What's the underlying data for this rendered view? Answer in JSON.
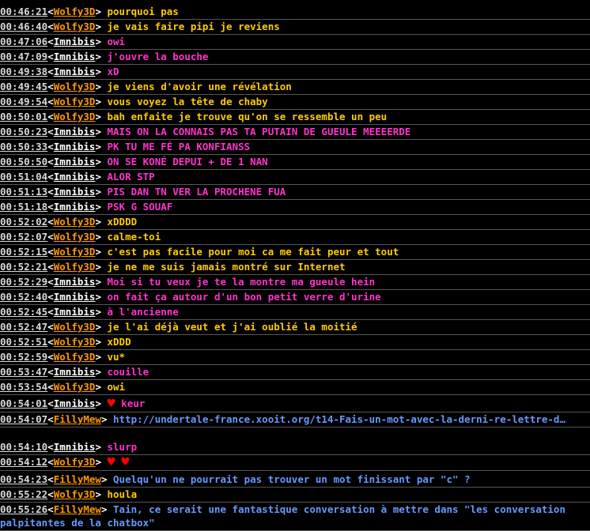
{
  "colors": {
    "wolfy": "#ff9900",
    "imnibis": "#ffffff",
    "fillymew": "#ff9900",
    "wolfy_text": "#ffcc00",
    "imnibis_text": "#ff33cc",
    "fillymew_text": "#6699ff",
    "heart": "#ff0000"
  },
  "messages": [
    {
      "time": "00:46:21",
      "nick": "Wolfy3D",
      "text": "pourquoi pas",
      "hearts": 0
    },
    {
      "time": "00:46:40",
      "nick": "Wolfy3D",
      "text": "je vais faire pipi je reviens",
      "hearts": 0
    },
    {
      "time": "00:47:06",
      "nick": "Imnibis",
      "text": "owi",
      "hearts": 0
    },
    {
      "time": "00:47:09",
      "nick": "Imnibis",
      "text": "j'ouvre la bouche",
      "hearts": 0
    },
    {
      "time": "00:49:38",
      "nick": "Imnibis",
      "text": "xD",
      "hearts": 0
    },
    {
      "time": "00:49:45",
      "nick": "Wolfy3D",
      "text": "je viens d'avoir une révélation",
      "hearts": 0
    },
    {
      "time": "00:49:54",
      "nick": "Wolfy3D",
      "text": "vous voyez la tête de chaby",
      "hearts": 0
    },
    {
      "time": "00:50:01",
      "nick": "Wolfy3D",
      "text": "bah enfaite je trouve qu'on se ressemble un peu",
      "hearts": 0
    },
    {
      "time": "00:50:23",
      "nick": "Imnibis",
      "text": "MAIS ON LA CONNAIS PAS TA PUTAIN DE GUEULE MEEEERDE",
      "hearts": 0
    },
    {
      "time": "00:50:33",
      "nick": "Imnibis",
      "text": "PK TU ME FÉ PA KONFIANSS",
      "hearts": 0
    },
    {
      "time": "00:50:50",
      "nick": "Imnibis",
      "text": "ON SE KONÉ DEPUI + DE 1 NAN",
      "hearts": 0
    },
    {
      "time": "00:51:04",
      "nick": "Imnibis",
      "text": "ALOR STP",
      "hearts": 0
    },
    {
      "time": "00:51:13",
      "nick": "Imnibis",
      "text": "PIS DAN TN VER LA PROCHENE FUA",
      "hearts": 0
    },
    {
      "time": "00:51:18",
      "nick": "Imnibis",
      "text": "PSK G SOUAF",
      "hearts": 0
    },
    {
      "time": "00:52:02",
      "nick": "Wolfy3D",
      "text": "xDDDD",
      "hearts": 0
    },
    {
      "time": "00:52:07",
      "nick": "Wolfy3D",
      "text": "calme-toi",
      "hearts": 0
    },
    {
      "time": "00:52:15",
      "nick": "Wolfy3D",
      "text": "c'est pas facile pour moi ca me fait peur et tout",
      "hearts": 0
    },
    {
      "time": "00:52:21",
      "nick": "Wolfy3D",
      "text": "je ne me suis jamais montré sur Internet",
      "hearts": 0
    },
    {
      "time": "00:52:29",
      "nick": "Imnibis",
      "text": "Moi si tu veux je te la montre ma gueule hein",
      "hearts": 0
    },
    {
      "time": "00:52:40",
      "nick": "Imnibis",
      "text": "on fait ça autour d'un bon petit verre d'urine",
      "hearts": 0
    },
    {
      "time": "00:52:45",
      "nick": "Imnibis",
      "text": "à l'ancienne",
      "hearts": 0
    },
    {
      "time": "00:52:47",
      "nick": "Wolfy3D",
      "text": "je l'ai déjà veut et j'ai oublié la moitié",
      "hearts": 0
    },
    {
      "time": "00:52:51",
      "nick": "Wolfy3D",
      "text": "xDDD",
      "hearts": 0
    },
    {
      "time": "00:52:59",
      "nick": "Wolfy3D",
      "text": "vu*",
      "hearts": 0
    },
    {
      "time": "00:53:47",
      "nick": "Imnibis",
      "text": "couille",
      "hearts": 0
    },
    {
      "time": "00:53:54",
      "nick": "Wolfy3D",
      "text": "owi",
      "hearts": 0
    },
    {
      "time": "00:54:01",
      "nick": "Imnibis",
      "text": "keur",
      "hearts": 1
    },
    {
      "time": "00:54:07",
      "nick": "FillyMew",
      "text": "http://undertale-france.xooit.org/t14-Fais-un-mot-avec-la-derni-re-lettre-d…",
      "hearts": 0
    },
    {
      "time": "00:54:10",
      "nick": "Imnibis",
      "text": "slurp",
      "hearts": 0
    },
    {
      "time": "00:54:12",
      "nick": "Wolfy3D",
      "text": "",
      "hearts": 2
    },
    {
      "time": "00:54:23",
      "nick": "FillyMew",
      "text": "Quelqu'un ne pourrait pas trouver un mot finissant par \"c\" ?",
      "hearts": 0
    },
    {
      "time": "00:55:22",
      "nick": "Wolfy3D",
      "text": "houla",
      "hearts": 0
    },
    {
      "time": "00:55:26",
      "nick": "FillyMew",
      "text": "Tain, ce serait une fantastique conversation à mettre dans \"les conversation palpitantes de la chatbox\"",
      "hearts": 0
    }
  ]
}
